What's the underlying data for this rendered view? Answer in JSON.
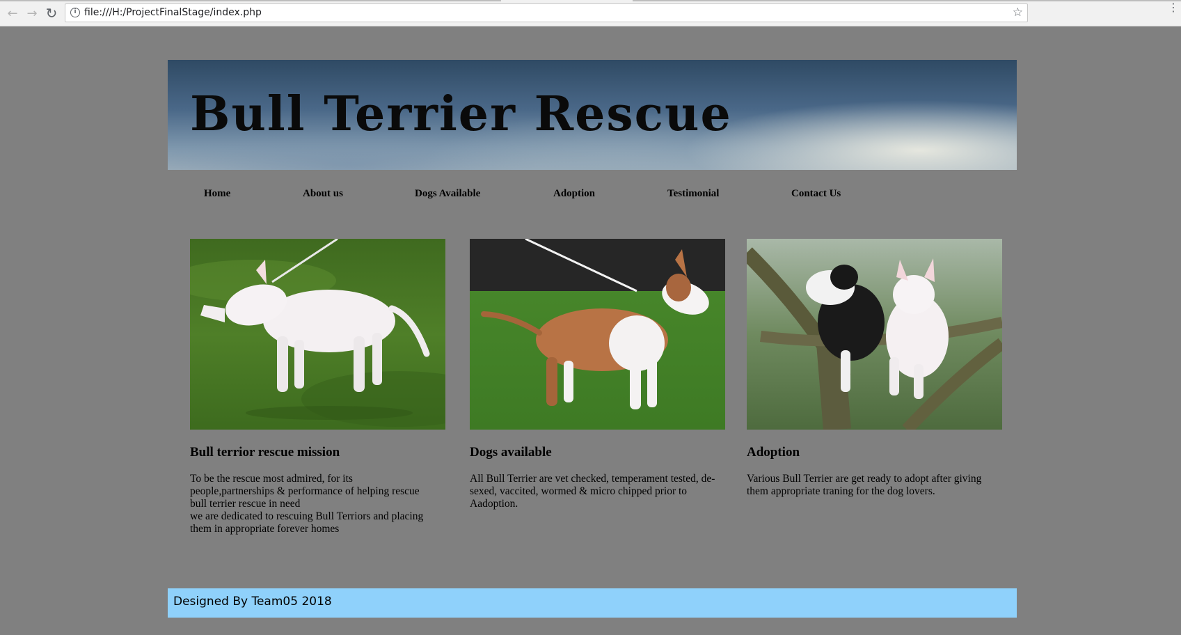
{
  "browser": {
    "url": "file:///H:/ProjectFinalStage/index.php",
    "back_icon": "←",
    "forward_icon": "→",
    "reload_icon": "↻",
    "info_icon": "i",
    "star_icon": "☆",
    "menu_icon": "⋮"
  },
  "header": {
    "title": "Bull Terrier Rescue"
  },
  "nav": {
    "items": [
      {
        "label": "Home"
      },
      {
        "label": "About us"
      },
      {
        "label": "Dogs Available"
      },
      {
        "label": "Adoption"
      },
      {
        "label": "Testimonial"
      },
      {
        "label": "Contact Us"
      }
    ]
  },
  "cards": [
    {
      "title": "Bull terrior rescue mission",
      "text_lines": [
        "To be the rescue most admired, for its",
        "people,partnerships & performance of helping rescue",
        "bull terrier rescue in need",
        "we are dedicated to rescuing Bull Terriors and placing",
        "them in appropriate forever homes"
      ],
      "image": "white bull terrier on grass"
    },
    {
      "title": "Dogs available",
      "text_lines": [
        "All Bull Terrier are vet checked, temperament tested, de-",
        "sexed, vaccited, wormed & micro chipped prior to",
        "Aadoption."
      ],
      "image": "brown and white bull terrier on leash"
    },
    {
      "title": "Adoption",
      "text_lines": [
        "Various Bull Terrier are get ready to adopt after giving",
        "them appropriate traning for the dog lovers."
      ],
      "image": "two bull terriers in a tree"
    }
  ],
  "footer": {
    "text": "Designed By Team05 2018"
  },
  "colors": {
    "page_bg": "#808080",
    "footer_bg": "#8fd1fb"
  }
}
